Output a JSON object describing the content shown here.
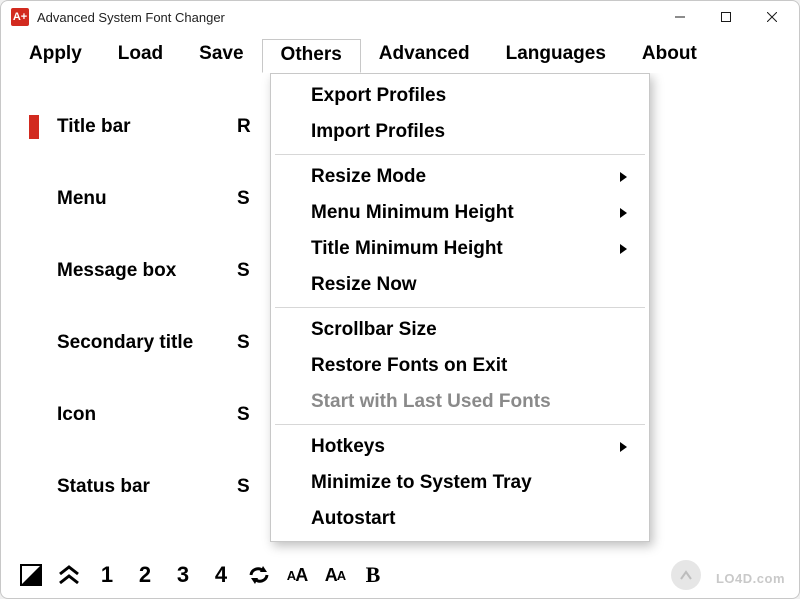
{
  "window": {
    "title": "Advanced System Font Changer",
    "icon_text": "A+"
  },
  "menubar": {
    "items": [
      {
        "label": "Apply"
      },
      {
        "label": "Load"
      },
      {
        "label": "Save"
      },
      {
        "label": "Others",
        "open": true
      },
      {
        "label": "Advanced"
      },
      {
        "label": "Languages"
      },
      {
        "label": "About"
      }
    ]
  },
  "rows": [
    {
      "label": "Title bar",
      "value_preview": "R",
      "active": true
    },
    {
      "label": "Menu",
      "value_preview": "S",
      "active": false
    },
    {
      "label": "Message box",
      "value_preview": "S",
      "active": false
    },
    {
      "label": "Secondary title",
      "value_preview": "S",
      "active": false
    },
    {
      "label": "Icon",
      "value_preview": "S",
      "active": false
    },
    {
      "label": "Status bar",
      "value_preview": "S",
      "active": false
    }
  ],
  "dropdown": {
    "groups": [
      [
        {
          "label": "Export Profiles",
          "submenu": false,
          "disabled": false
        },
        {
          "label": "Import Profiles",
          "submenu": false,
          "disabled": false
        }
      ],
      [
        {
          "label": "Resize Mode",
          "submenu": true,
          "disabled": false
        },
        {
          "label": "Menu Minimum Height",
          "submenu": true,
          "disabled": false
        },
        {
          "label": "Title Minimum Height",
          "submenu": true,
          "disabled": false
        },
        {
          "label": "Resize Now",
          "submenu": false,
          "disabled": false
        }
      ],
      [
        {
          "label": "Scrollbar Size",
          "submenu": false,
          "disabled": false
        },
        {
          "label": "Restore Fonts on Exit",
          "submenu": false,
          "disabled": false
        },
        {
          "label": "Start with Last Used Fonts",
          "submenu": false,
          "disabled": true
        }
      ],
      [
        {
          "label": "Hotkeys",
          "submenu": true,
          "disabled": false
        },
        {
          "label": "Minimize to System Tray",
          "submenu": false,
          "disabled": false
        },
        {
          "label": "Autostart",
          "submenu": false,
          "disabled": false
        }
      ]
    ]
  },
  "toolbar": {
    "items": [
      {
        "name": "contrast-icon",
        "glyph_svg": "triangle"
      },
      {
        "name": "collapse-icon",
        "text": "︽"
      },
      {
        "name": "preset-1",
        "text": "1"
      },
      {
        "name": "preset-2",
        "text": "2"
      },
      {
        "name": "preset-3",
        "text": "3"
      },
      {
        "name": "preset-4",
        "text": "4"
      },
      {
        "name": "refresh-icon",
        "glyph_svg": "refresh"
      },
      {
        "name": "font-size-small-icon",
        "text": "ᴀA"
      },
      {
        "name": "font-size-large-icon",
        "text": "Aᴀ"
      },
      {
        "name": "bold-icon",
        "text": "B"
      }
    ]
  },
  "watermark": {
    "text": "LO4D.com"
  }
}
